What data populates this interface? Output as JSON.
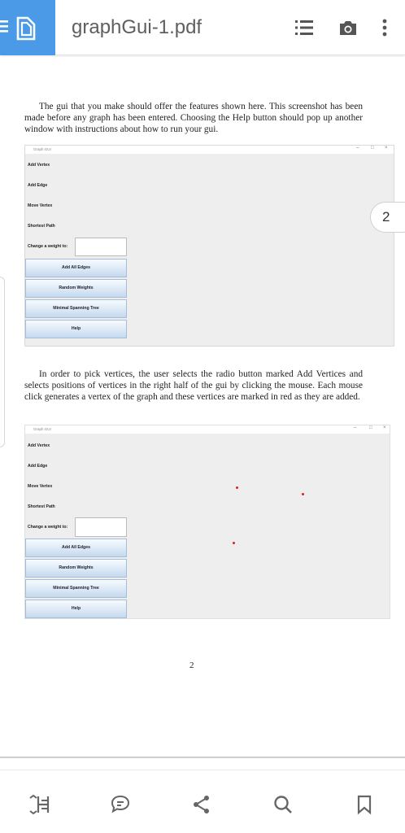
{
  "toolbar": {
    "doc_title": "graphGui-1.pdf",
    "accent": "#4a9ae8"
  },
  "page": {
    "para1": "The gui that you make should offer the features shown here. This screenshot has been made before any graph has been entered. Choosing the Help button should pop up another window with instructions about how to run your gui.",
    "para2": "In order to pick vertices, the user selects the radio button marked Add Vertices and selects positions of vertices in the right half of the gui by clicking the mouse. Each mouse click generates a vertex of the graph and these vertices are marked in red as they are added.",
    "page_number": "2",
    "page_badge": "2"
  },
  "screenshot1": {
    "window_title": "Graph GUI",
    "radio_add_vertex": "Add Vertex",
    "radio_add_edge": "Add Edge",
    "radio_move_vertex": "Move Vertex",
    "radio_shortest_path": "Shortest Path",
    "weight_label": "Change a weight to:",
    "btn_add_all_edges": "Add All Edges",
    "btn_random_weights": "Random Weights",
    "btn_mst": "Minimal Spanning Tree",
    "btn_help": "Help"
  },
  "screenshot2": {
    "window_title": "Graph GUI",
    "radio_add_vertex": "Add Vertex",
    "radio_add_edge": "Add Edge",
    "radio_move_vertex": "Move Vertex",
    "radio_shortest_path": "Shortest Path",
    "weight_label": "Change a weight to:",
    "btn_add_all_edges": "Add All Edges",
    "btn_random_weights": "Random Weights",
    "btn_mst": "Minimal Spanning Tree",
    "btn_help": "Help",
    "vertex_color": "#e02020"
  },
  "bottom": {
    "icons": [
      "reading-mode-icon",
      "annotate-icon",
      "share-icon",
      "search-icon",
      "bookmark-icon"
    ]
  }
}
